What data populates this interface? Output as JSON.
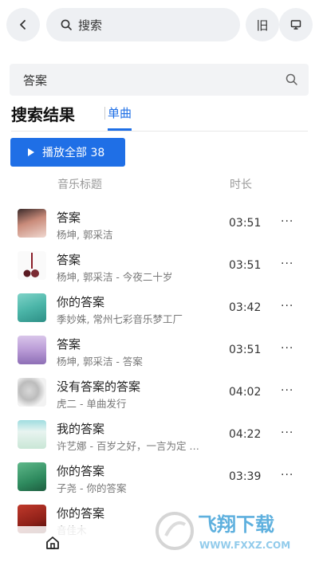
{
  "topbar": {
    "search_label": "搜索",
    "icon_btn_1": "旧"
  },
  "search": {
    "value": "答案"
  },
  "results": {
    "title": "搜索结果",
    "tab": "单曲"
  },
  "play_all": {
    "label": "播放全部 38"
  },
  "columns": {
    "title": "音乐标题",
    "duration": "时长"
  },
  "songs": [
    {
      "title": "答案",
      "artist": "杨坤, 郭采洁",
      "duration": "03:51"
    },
    {
      "title": "答案",
      "artist": "杨坤, 郭采洁 - 今夜二十岁",
      "duration": "03:51"
    },
    {
      "title": "你的答案",
      "artist": "季妙姝, 常州七彩音乐梦工厂",
      "duration": "03:42"
    },
    {
      "title": "答案",
      "artist": "杨坤, 郭采洁 - 答案",
      "duration": "03:51"
    },
    {
      "title": "没有答案的答案",
      "artist": "虎二 - 单曲发行",
      "duration": "04:02"
    },
    {
      "title": "我的答案",
      "artist": "许艺娜 - 百岁之好，一言为定 …",
      "duration": "04:22"
    },
    {
      "title": "你的答案",
      "artist": "子尧 - 你的答案",
      "duration": "03:39"
    },
    {
      "title": "你的答案",
      "artist": "音佳木",
      "duration": ""
    }
  ],
  "more_glyph": "···",
  "watermark": {
    "brand": "飞翔下载",
    "url": "WWW.FXXZ.COM"
  },
  "colors": {
    "accent": "#1f6fe6",
    "pill_bg": "#eef0f3"
  }
}
